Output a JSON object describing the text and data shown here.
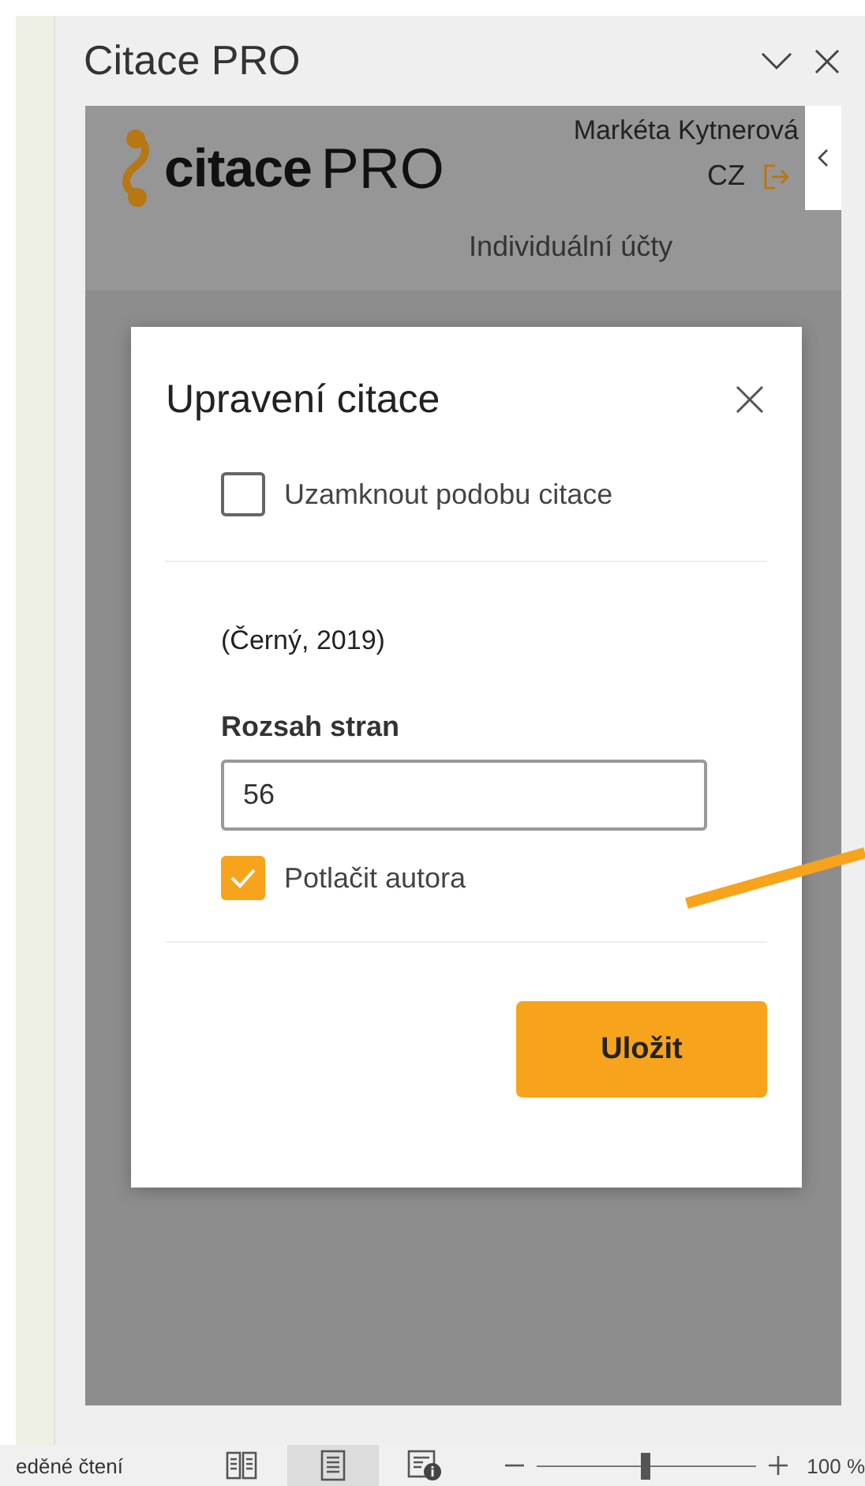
{
  "pane": {
    "title": "Citace PRO"
  },
  "header": {
    "logo_word": "citace",
    "logo_suffix": "PRO",
    "user": "Markéta Kytnerová",
    "language": "CZ",
    "account_type": "Individuální účty"
  },
  "dialog": {
    "title": "Upravení citace",
    "lock_checkbox": {
      "label": "Uzamknout podobu citace",
      "checked": false
    },
    "citation": "(Černý, 2019)",
    "page_range": {
      "label": "Rozsah stran",
      "value": "56"
    },
    "suppress_author": {
      "label": "Potlačit autora",
      "checked": true
    },
    "save_button": "Uložit"
  },
  "status_bar": {
    "view_label": "eděné čtení",
    "views": [
      {
        "kind": "reading",
        "selected": false
      },
      {
        "kind": "print",
        "selected": true
      },
      {
        "kind": "web",
        "selected": false
      }
    ],
    "zoom": {
      "level": 0.5,
      "reading": "100 %"
    }
  }
}
